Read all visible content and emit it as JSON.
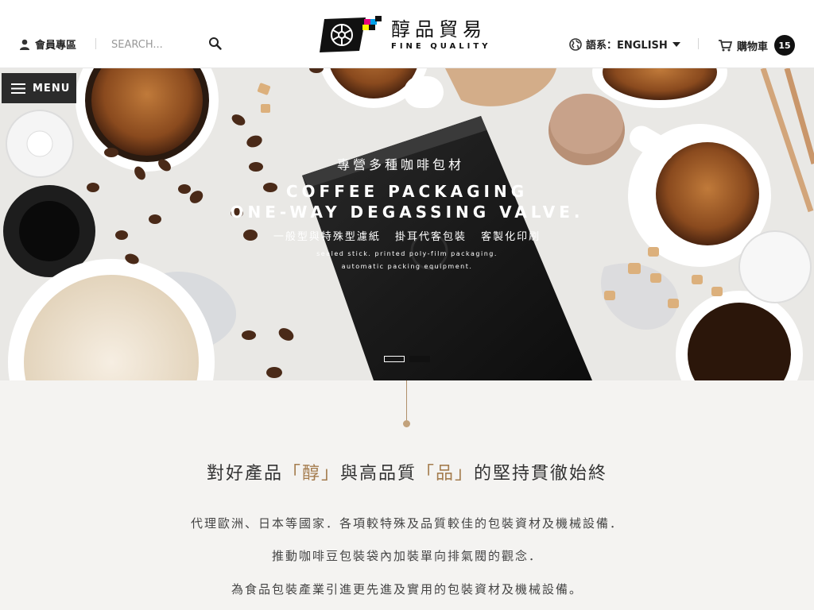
{
  "header": {
    "member_label": "會員專區",
    "search_placeholder": "SEARCH...",
    "logo_cn": "醇品貿易",
    "logo_en": "FINE QUALITY",
    "lang_label": "語系：ENGLISH",
    "cart_label": "購物車",
    "cart_count": "15"
  },
  "menu": {
    "label": "MENU"
  },
  "hero": {
    "subtitle": "專營多種咖啡包材",
    "title_line1": "COFFEE PACKAGING",
    "title_line2": "ONE-WAY DEGASSING VALVE.",
    "services": "一般型與特殊型濾紙 掛耳代客包裝 客製化印刷",
    "small_line1": "sealed stick. printed poly-film packaging.",
    "small_line2": "automatic packing equipment.",
    "slide_count": 2,
    "active_slide": 2
  },
  "intro": {
    "title_pre": "對好產品",
    "title_hl1": "「醇」",
    "title_mid": "與高品質",
    "title_hl2": "「品」",
    "title_post": "的堅持貫徹始終",
    "p1": "代理歐洲、日本等國家．各項較特殊及品質較佳的包裝資材及機械設備．",
    "p2": "推動咖啡豆包裝袋內加裝單向排氣閥的觀念．",
    "p3": "為食品包裝產業引進更先進及實用的包裝資材及機械設備。"
  },
  "colors": {
    "accent": "#a47c4e",
    "dark": "#2b2b2b",
    "hero_bg": "#e9e8e5"
  }
}
